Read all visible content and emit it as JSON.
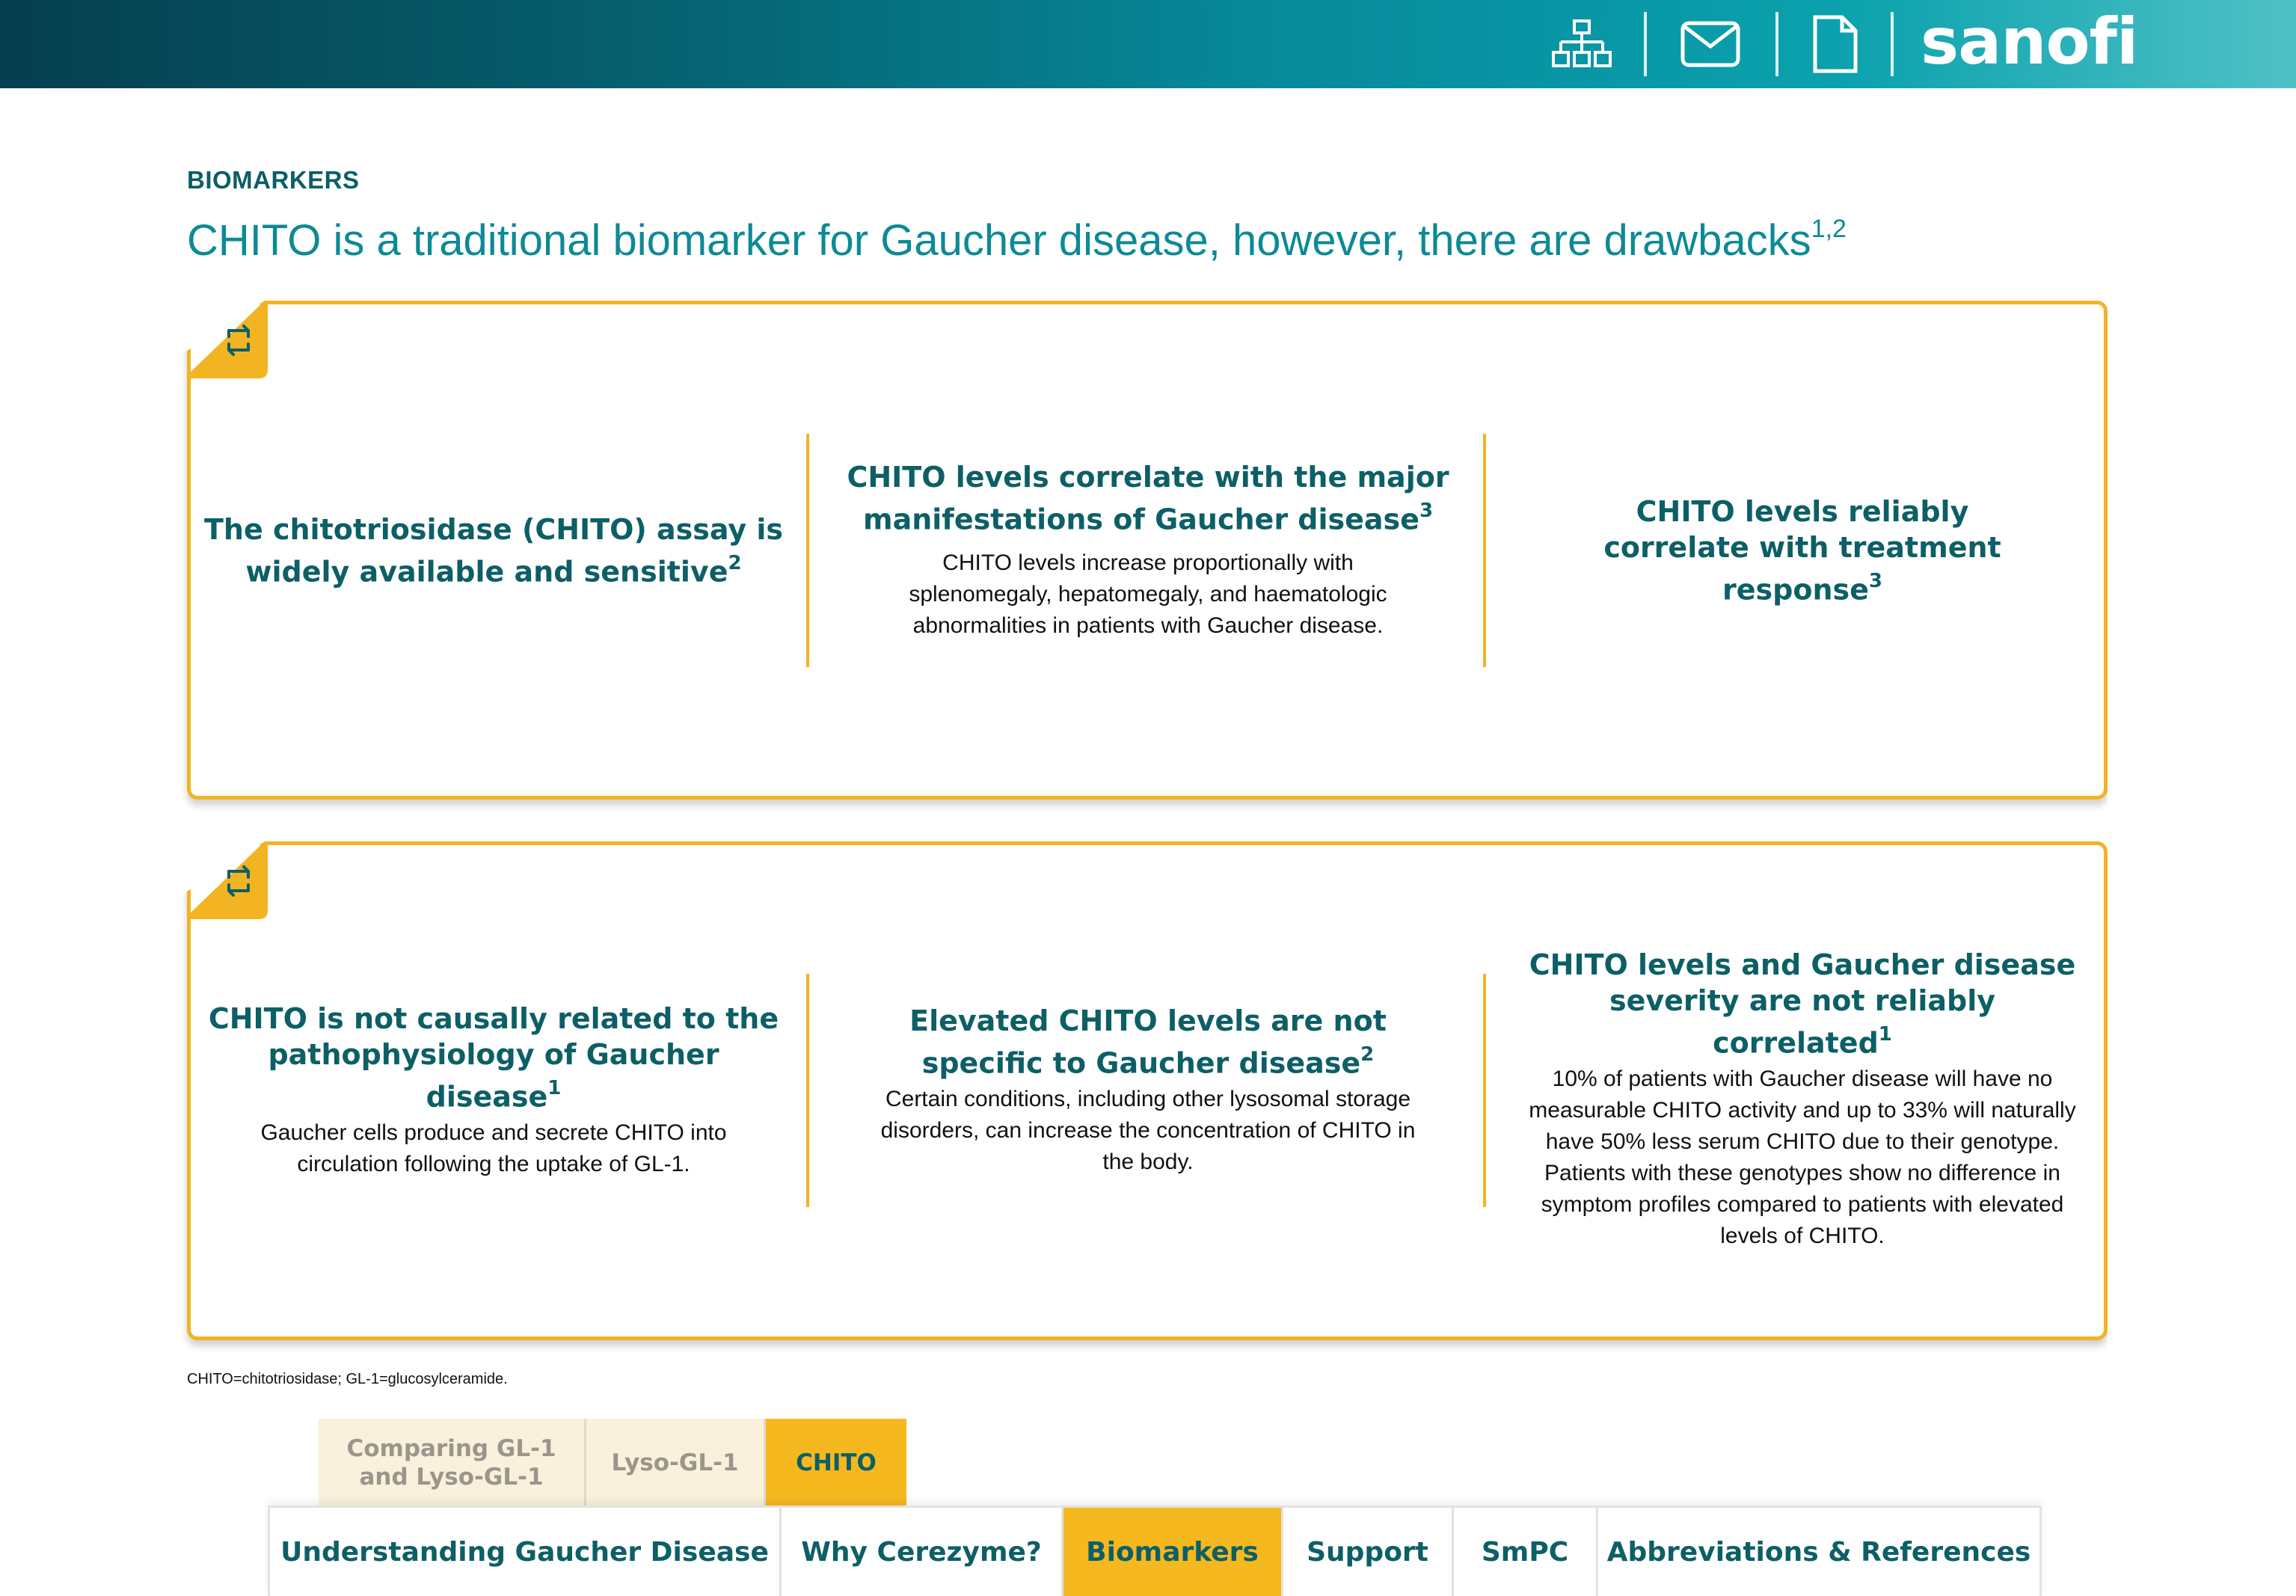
{
  "header": {
    "icons": [
      "sitemap-icon",
      "mail-icon",
      "document-icon"
    ],
    "logo_text": "sanofi",
    "colors": {
      "bar_start": "#063f4f",
      "bar_end": "#4fc1c5"
    }
  },
  "page": {
    "eyebrow": "BIOMARKERS",
    "title": "CHITO is a traditional biomarker for Gaucher disease, however, there are drawbacks",
    "title_refs": "1,2"
  },
  "cards": [
    {
      "flip_icon": "flip-arrows-icon",
      "columns": [
        {
          "heading": "The chitotriosidase (CHITO) assay is widely available and sensitive",
          "ref": "2",
          "body": ""
        },
        {
          "heading": "CHITO levels correlate with the major manifestations of Gaucher disease",
          "ref": "3",
          "body": "CHITO levels increase proportionally with splenomegaly, hepatomegaly, and haematologic abnormalities in patients with Gaucher disease."
        },
        {
          "heading": "CHITO levels reliably correlate with treatment response",
          "ref": "3",
          "body": ""
        }
      ]
    },
    {
      "flip_icon": "flip-arrows-icon",
      "columns": [
        {
          "heading": "CHITO is not causally related to the pathophysiology of Gaucher disease",
          "ref": "1",
          "body": "Gaucher cells produce and secrete CHITO into circulation following the uptake of GL-1."
        },
        {
          "heading": "Elevated CHITO levels are not specific to Gaucher disease",
          "ref": "2",
          "body": "Certain conditions, including other lysosomal storage disorders, can increase the concentration of CHITO in the body."
        },
        {
          "heading": "CHITO levels and Gaucher disease severity are not reliably correlated",
          "ref": "1",
          "body": "10% of patients with Gaucher disease will have no measurable CHITO activity and up to 33% will naturally have 50% less serum CHITO due to their genotype. Patients with these genotypes show no difference in symptom profiles compared to patients with elevated levels of CHITO."
        }
      ]
    }
  ],
  "footnote": "CHITO=chitotriosidase; GL-1=glucosylceramide.",
  "subtabs": [
    {
      "label": "Comparing GL-1 and Lyso-GL-1",
      "active": false
    },
    {
      "label": "Lyso-GL-1",
      "active": false
    },
    {
      "label": "CHITO",
      "active": true
    }
  ],
  "nav": [
    {
      "label": "Understanding Gaucher Disease",
      "active": false
    },
    {
      "label": "Why Cerezyme?",
      "active": false
    },
    {
      "label": "Biomarkers",
      "active": true
    },
    {
      "label": "Support",
      "active": false
    },
    {
      "label": "SmPC",
      "active": false
    },
    {
      "label": "Abbreviations & References",
      "active": false
    }
  ],
  "colors": {
    "accent": "#f2b422",
    "teal": "#0d5f66",
    "title": "#0c8a96"
  }
}
